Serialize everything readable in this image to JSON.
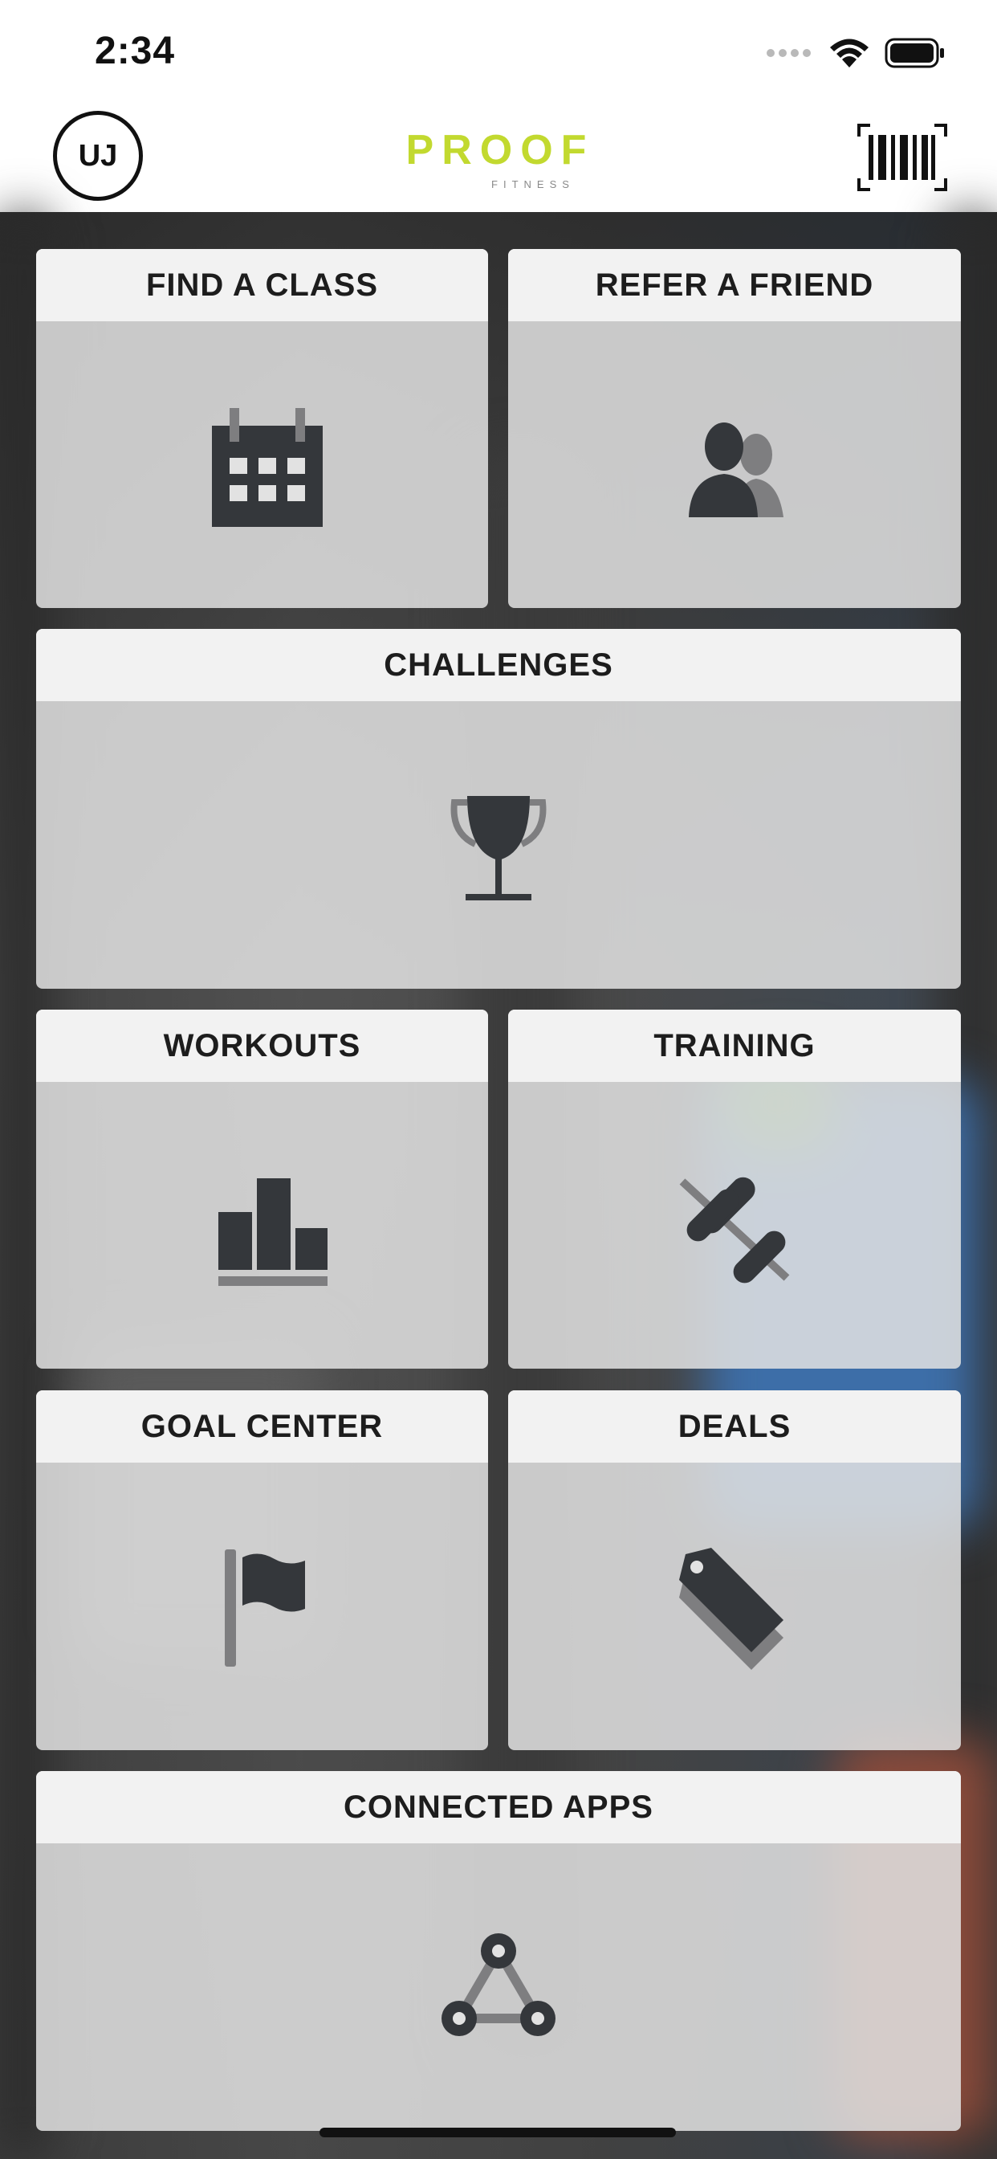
{
  "status_bar": {
    "time": "2:34",
    "icons": [
      "signal-dots-icon",
      "wifi-icon",
      "battery-icon"
    ]
  },
  "header": {
    "avatar_initials": "UJ",
    "logo": {
      "text": "PROOF",
      "subtext": "FITNESS",
      "brand_color": "#c2d92f"
    },
    "barcode_icon": "barcode-icon"
  },
  "tiles": [
    {
      "label": "FIND A CLASS",
      "icon": "calendar-icon"
    },
    {
      "label": "REFER A FRIEND",
      "icon": "friends-icon"
    },
    {
      "label": "CHALLENGES",
      "icon": "trophy-icon"
    },
    {
      "label": "WORKOUTS",
      "icon": "bar-chart-icon"
    },
    {
      "label": "TRAINING",
      "icon": "dumbbell-icon"
    },
    {
      "label": "GOAL CENTER",
      "icon": "flag-icon"
    },
    {
      "label": "DEALS",
      "icon": "tag-icon"
    },
    {
      "label": "CONNECTED APPS",
      "icon": "network-icon"
    }
  ],
  "colors": {
    "icon_dark": "#34373b",
    "icon_mid": "#7e7e80",
    "tile_header_bg": "#f2f2f2"
  }
}
